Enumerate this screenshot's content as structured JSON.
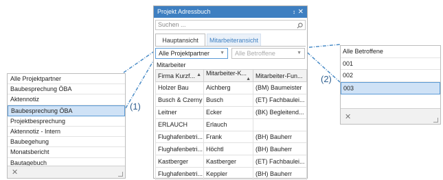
{
  "panel": {
    "title": "Projekt Adressbuch",
    "pin_glyph": "↕",
    "close_glyph": "✕",
    "search_placeholder": "Suchen ...",
    "tabs": [
      {
        "label": "Hauptansicht"
      },
      {
        "label": "Mitarbeiteransicht"
      }
    ],
    "filter1_value": "Alle Projektpartner",
    "filter2_value": "Alle Betroffene",
    "grid_title": "Mitarbeiter",
    "columns": [
      "Firma Kurzf...",
      "Mitarbeiter-K...",
      "Mitarbeiter-Fun..."
    ],
    "rows": [
      [
        "Holzer Bau",
        "Aichberg",
        "(BM) Baumeister"
      ],
      [
        "Busch & Czerny",
        "Busch",
        "(ET) Fachbaulei..."
      ],
      [
        "Leitner",
        "Ecker",
        "(BK) Begleitend..."
      ],
      [
        "ERLAUCH",
        "Erlauch",
        ""
      ],
      [
        "Flughafenbetri...",
        "Frank",
        "(BH) Bauherr"
      ],
      [
        "Flughafenbetri...",
        "Höchtl",
        "(BH) Bauherr"
      ],
      [
        "Kastberger",
        "Kastberger",
        "(ET) Fachbaulei..."
      ],
      [
        "Flughafenbetri...",
        "Keppler",
        "(BH) Bauherr"
      ]
    ]
  },
  "left_dropdown": {
    "items": [
      "Alle Projektpartner",
      "Baubesprechung ÖBA",
      "Aktennotiz",
      "Baubesprechung ÖBA",
      "Projektbesprechung",
      "Aktennotiz - Intern",
      "Baubegehung",
      "Monatsbericht",
      "Bautagebuch"
    ],
    "selected_index": 3,
    "clear_glyph": "✕"
  },
  "right_dropdown": {
    "items": [
      "Alle Betroffene",
      "001",
      "002",
      "003"
    ],
    "selected_index": 3,
    "clear_glyph": "✕"
  },
  "callouts": {
    "one": "(1)",
    "two": "(2)"
  },
  "colors": {
    "accent": "#3e7fc1",
    "selection": "#cfe2f6",
    "connector": "#4a8cc7"
  }
}
